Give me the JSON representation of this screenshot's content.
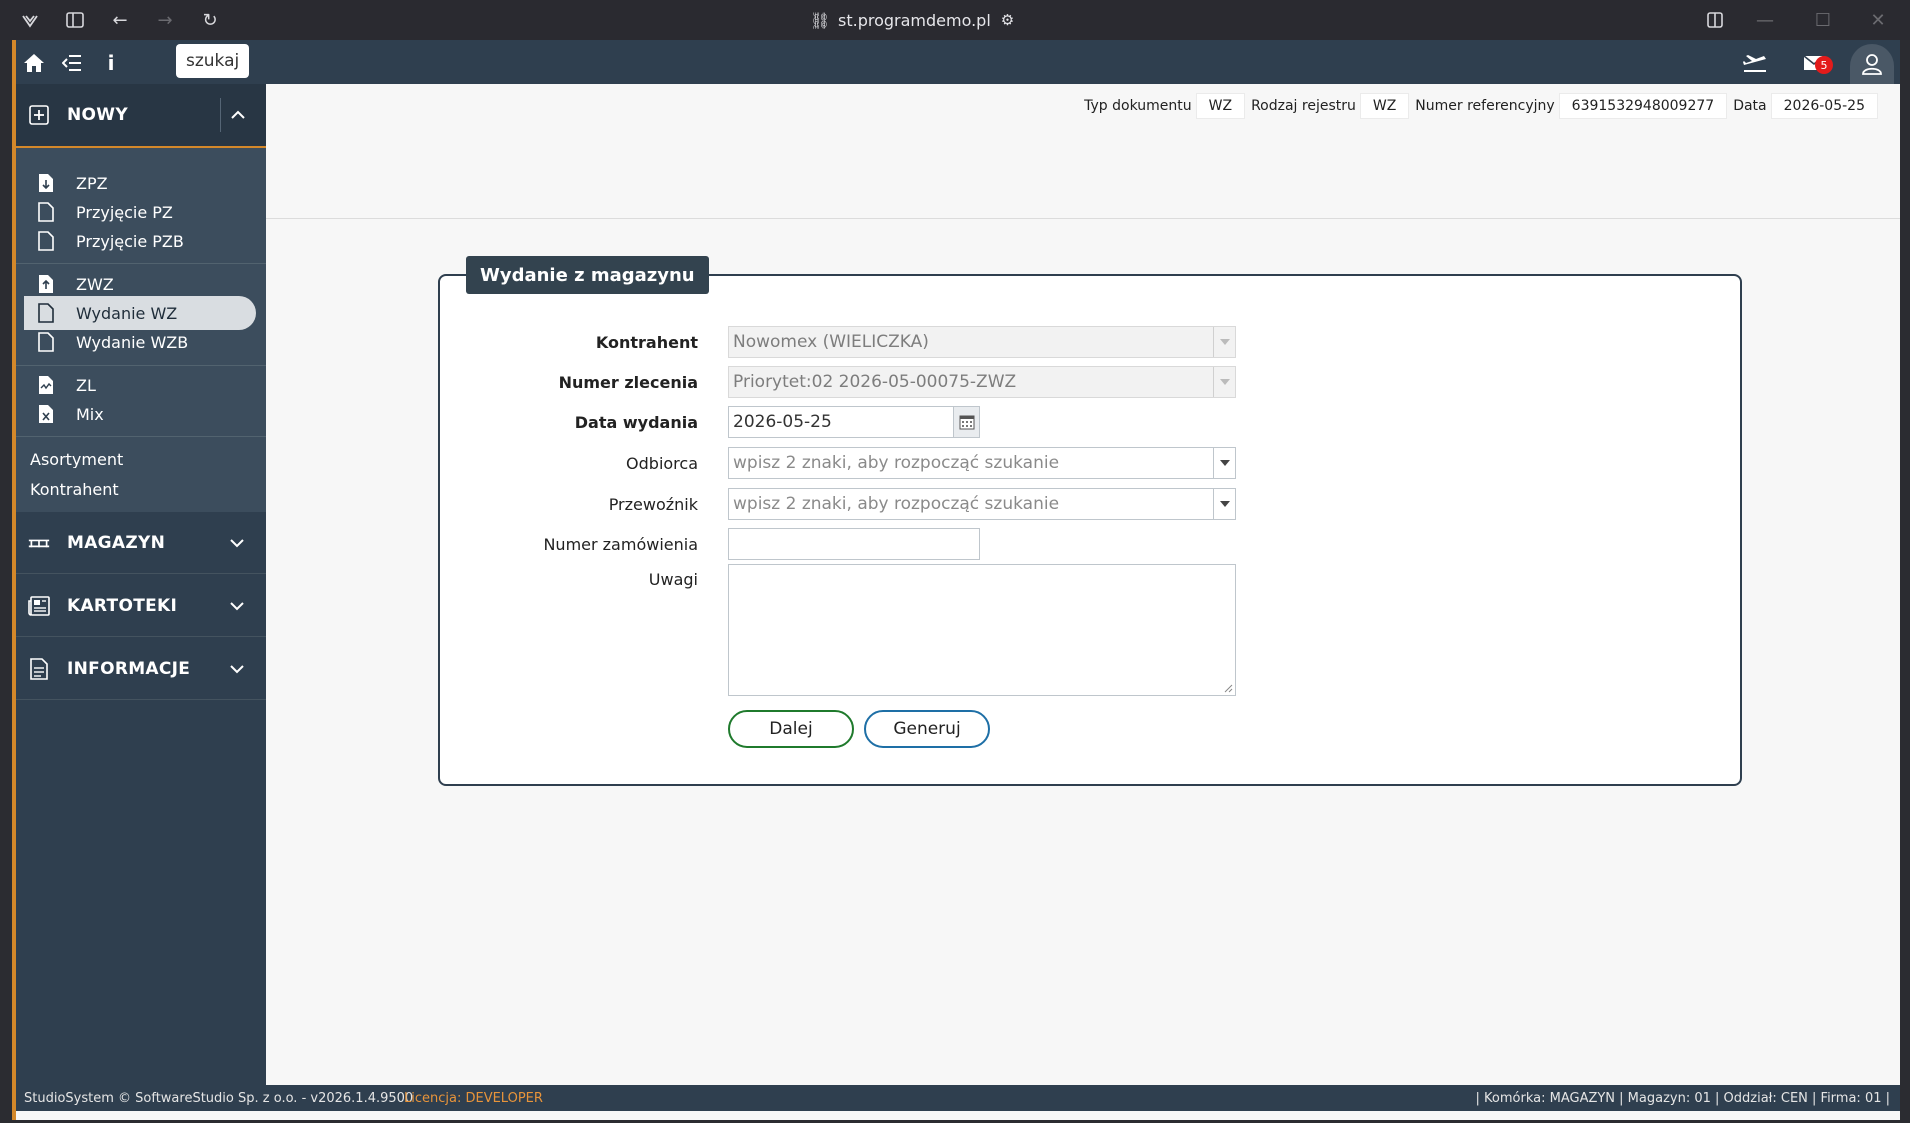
{
  "browser": {
    "url": "st.programdemo.pl",
    "icons": [
      "logo-icon",
      "sidebar-toggle-icon",
      "back-icon",
      "forward-icon",
      "reload-icon",
      "link-icon",
      "tune-icon",
      "split-view-icon",
      "minimize-icon",
      "maximize-icon",
      "close-icon"
    ]
  },
  "topbar": {
    "search_label": "szukaj",
    "mail_count": "5"
  },
  "sidebar": {
    "nowy": {
      "label": "NOWY"
    },
    "group1": [
      {
        "label": "ZPZ"
      },
      {
        "label": "Przyjęcie PZ"
      },
      {
        "label": "Przyjęcie PZB"
      }
    ],
    "group2": [
      {
        "label": "ZWZ"
      },
      {
        "label": "Wydanie WZ"
      },
      {
        "label": "Wydanie WZB"
      }
    ],
    "group3": [
      {
        "label": "ZL"
      },
      {
        "label": "Mix"
      }
    ],
    "plain": [
      {
        "label": "Asortyment"
      },
      {
        "label": "Kontrahent"
      }
    ],
    "sections": [
      {
        "label": "MAGAZYN"
      },
      {
        "label": "KARTOTEKI"
      },
      {
        "label": "INFORMACJE"
      }
    ]
  },
  "doc_header": {
    "typ_label": "Typ dokumentu",
    "typ_value": "WZ",
    "rodzaj_label": "Rodzaj rejestru",
    "rodzaj_value": "WZ",
    "numer_label": "Numer referencyjny",
    "numer_value": "6391532948009277",
    "data_label": "Data",
    "data_value": "2026-05-25"
  },
  "form": {
    "legend": "Wydanie z magazynu",
    "kontrahent": {
      "label": "Kontrahent",
      "value": "Nowomex (WIELICZKA)"
    },
    "numer_zlecenia": {
      "label": "Numer zlecenia",
      "value": "Priorytet:02 2026-05-00075-ZWZ"
    },
    "data_wydania": {
      "label": "Data wydania",
      "value": "2026-05-25"
    },
    "odbiorca": {
      "label": "Odbiorca",
      "placeholder": "wpisz 2 znaki, aby rozpocząć szukanie"
    },
    "przewoznik": {
      "label": "Przewoźnik",
      "placeholder": "wpisz 2 znaki, aby rozpocząć szukanie"
    },
    "numer_zamowienia": {
      "label": "Numer zamówienia",
      "value": ""
    },
    "uwagi": {
      "label": "Uwagi",
      "value": ""
    },
    "btn_dalej": "Dalej",
    "btn_generuj": "Generuj"
  },
  "footer": {
    "left": "StudioSystem © SoftwareStudio Sp. z o.o. - v2026.1.4.9500",
    "license": "Licencja: DEVELOPER",
    "right": "| Komórka: MAGAZYN | Magazyn: 01 | Oddział: CEN | Firma: 01 |"
  }
}
